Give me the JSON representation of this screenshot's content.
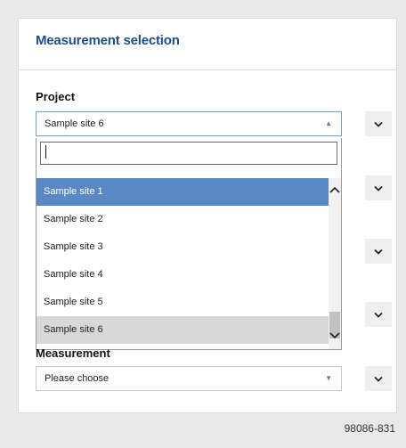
{
  "panel": {
    "title": "Measurement selection"
  },
  "project": {
    "label": "Project",
    "selected_value": "Sample site 6",
    "search_value": "",
    "options": [
      {
        "label": "Sample site 1",
        "state": "highlighted"
      },
      {
        "label": "Sample site 2",
        "state": "normal"
      },
      {
        "label": "Sample site 3",
        "state": "normal"
      },
      {
        "label": "Sample site 4",
        "state": "normal"
      },
      {
        "label": "Sample site 5",
        "state": "normal"
      },
      {
        "label": "Sample site 6",
        "state": "selected"
      }
    ],
    "dropdown_open": true
  },
  "measurement": {
    "label": "Measurement",
    "selected_value": "Please choose"
  },
  "figure_id": "98086-831",
  "colors": {
    "title": "#1c4f8a",
    "highlight": "#5a88c4",
    "selected": "#d8d8d8",
    "focus_border": "#6aa0d8"
  },
  "icons": {
    "side_buttons": "chevron-down-icon",
    "dropdown_arrow_open": "triangle-up-icon",
    "dropdown_arrow_closed": "triangle-down-icon"
  }
}
